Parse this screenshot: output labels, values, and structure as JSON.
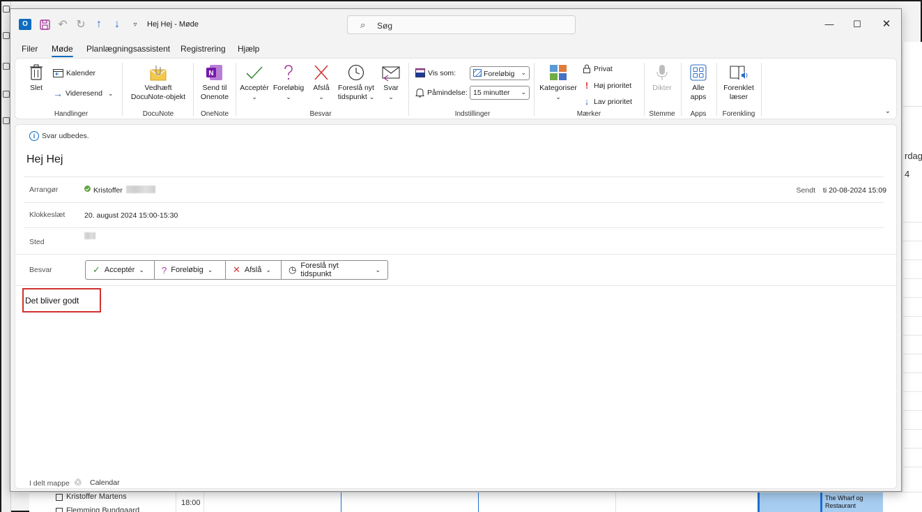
{
  "window": {
    "title": "Hej Hej  -  Møde",
    "search_placeholder": "Søg",
    "minimize": "—",
    "maximize": "☐",
    "close": "✕"
  },
  "tabs": [
    {
      "label": "Filer"
    },
    {
      "label": "Møde",
      "active": true
    },
    {
      "label": "Planlægningsassistent"
    },
    {
      "label": "Registrering"
    },
    {
      "label": "Hjælp"
    }
  ],
  "ribbon": {
    "handlinger": {
      "group": "Handlinger",
      "delete": "Slet",
      "calendar": "Kalender",
      "forward": "Videresend"
    },
    "docunote": {
      "group": "DocuNote",
      "attach_line1": "Vedhæft",
      "attach_line2": "DocuNote-objekt"
    },
    "onenote": {
      "group": "OneNote",
      "send_line1": "Send til",
      "send_line2": "Onenote"
    },
    "besvar": {
      "group": "Besvar",
      "accept": "Acceptér",
      "tentative": "Foreløbig",
      "decline": "Afslå",
      "propose_line1": "Foreslå nyt",
      "propose_line2": "tidspunkt",
      "reply": "Svar"
    },
    "indstillinger": {
      "group": "Indstillinger",
      "show_as_label": "Vis som:",
      "show_as_value": "Foreløbig",
      "reminder_label": "Påmindelse:",
      "reminder_value": "15 minutter"
    },
    "maerker": {
      "group": "Mærker",
      "categorize": "Kategoriser",
      "private": "Privat",
      "high": "Høj prioritet",
      "low": "Lav prioritet"
    },
    "stemme": {
      "group": "Stemme",
      "dictate": "Dikter"
    },
    "apps": {
      "group": "Apps",
      "all_line1": "Alle",
      "all_line2": "apps"
    },
    "forenkling": {
      "group": "Forenkling",
      "reader_line1": "Forenklet",
      "reader_line2": "læser"
    }
  },
  "meeting": {
    "info": "Svar udbedes.",
    "subject": "Hej Hej",
    "organizer_label": "Arrangør",
    "organizer_name": "Kristoffer",
    "sent_label": "Sendt",
    "sent_value": "ti 20-08-2024 15:09",
    "time_label": "Klokkeslæt",
    "time_value": "20. august 2024 15:00-15:30",
    "location_label": "Sted",
    "respond_label": "Besvar",
    "respond_buttons": {
      "accept": "Acceptér",
      "tentative": "Foreløbig",
      "decline": "Afslå",
      "propose": "Foreslå nyt tidspunkt"
    },
    "body": "Det bliver godt",
    "shared_label": "I delt mappe",
    "shared_folder": "Calendar"
  },
  "background": {
    "right_text_1": "rdag",
    "right_text_2": "4",
    "people": [
      "Kristoffer Martens",
      "Flemming Bundgaard"
    ],
    "time": "18:00",
    "event": "The Wharf og Restaurant"
  },
  "colors": {
    "accent": "#0f6cbd",
    "highlight_border": "#d32f2f",
    "decline": "#d13438",
    "accept": "#3c8d3c",
    "tentative": "#a4379a",
    "onenote": "#7719aa"
  }
}
